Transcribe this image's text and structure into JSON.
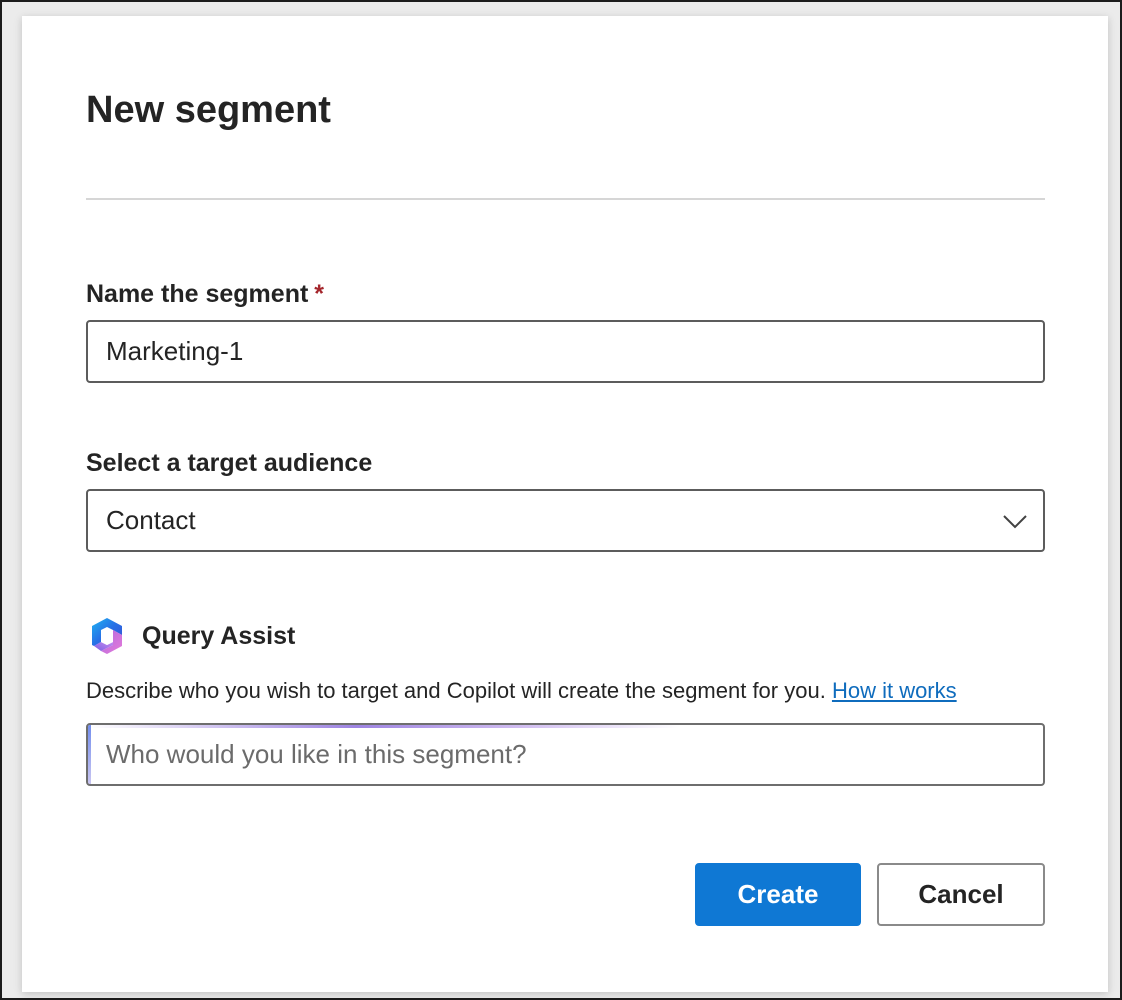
{
  "dialog": {
    "title": "New segment"
  },
  "name_field": {
    "label": "Name the segment",
    "required_marker": "*",
    "value": "Marketing-1"
  },
  "audience_field": {
    "label": "Select a target audience",
    "selected": "Contact"
  },
  "query_assist": {
    "title": "Query Assist",
    "icon": "copilot-icon",
    "description": "Describe who you wish to target and Copilot will create the segment for you.",
    "link_text": "How it works",
    "placeholder": "Who would you like in this segment?"
  },
  "actions": {
    "create_label": "Create",
    "cancel_label": "Cancel"
  },
  "colors": {
    "primary": "#0f78d4",
    "link": "#0f6cbd",
    "required": "#a4262c"
  }
}
